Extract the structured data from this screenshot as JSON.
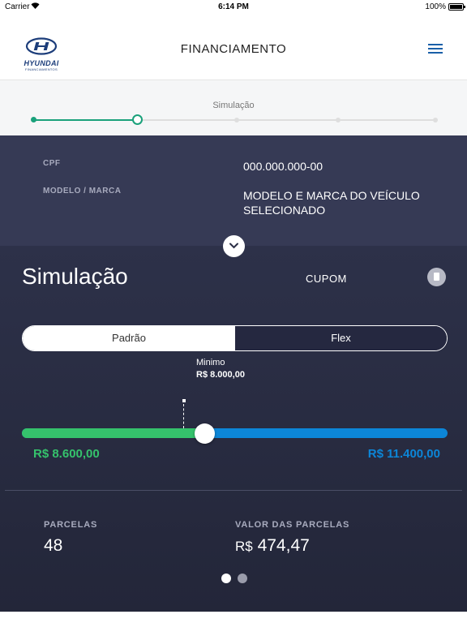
{
  "status_bar": {
    "carrier": "Carrier",
    "time": "6:14 PM",
    "battery": "100%"
  },
  "header": {
    "logo_text": "HYUNDAI",
    "logo_sub": "FINANCIAMENTOS",
    "title": "FINANCIAMENTO"
  },
  "stepper": {
    "current_label": "Simulação",
    "total_steps": 5,
    "current_step": 2
  },
  "info": {
    "cpf_label": "CPF",
    "cpf_value": "000.000.000-00",
    "model_label": "MODELO / MARCA",
    "model_value_line1": "MODELO E MARCA DO VEÍCULO",
    "model_value_line2": "SELECIONADO"
  },
  "simulation": {
    "title": "Simulação",
    "cupom_label": "CUPOM",
    "toggle": {
      "options": [
        "Padrão",
        "Flex"
      ],
      "selected": "Padrão"
    },
    "minimum_label": "Minimo",
    "minimum_value": "R$ 8.000,00",
    "slider_min": "R$ 8.600,00",
    "slider_max": "R$ 11.400,00",
    "slider_fraction": 0.43,
    "installments_label": "PARCELAS",
    "installments_value": "48",
    "installment_value_label": "VALOR DAS PARCELAS",
    "installment_currency": "R$",
    "installment_amount": "474,47",
    "pages": {
      "total": 2,
      "current": 1
    }
  },
  "colors": {
    "accent_green": "#35c26c",
    "accent_blue": "#0c86d8",
    "stepper_green": "#1aa17b",
    "brand_blue": "#1c3d7a"
  }
}
